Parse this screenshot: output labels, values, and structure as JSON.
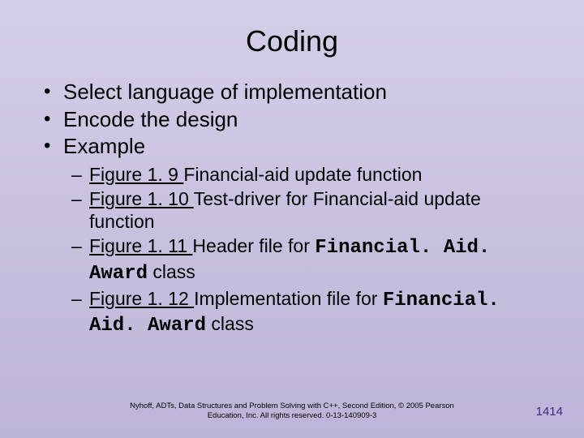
{
  "title": "Coding",
  "bullets": {
    "b1": "Select language of implementation",
    "b2": "Encode the design",
    "b3": "Example"
  },
  "sub": {
    "s1": {
      "link": "Figure 1. 9 ",
      "rest": "Financial-aid update function"
    },
    "s2": {
      "link": "Figure 1. 10 ",
      "rest": "Test-driver for Financial-aid update function"
    },
    "s3": {
      "link": "Figure 1. 11 ",
      "rest_a": "Header file for ",
      "code": "Financial. Aid. Award",
      "rest_b": " class"
    },
    "s4": {
      "link": "Figure 1. 12 ",
      "rest_a": "Implementation file for ",
      "code": "Financial. Aid. Award",
      "rest_b": " class"
    }
  },
  "footer": {
    "line1": "Nyhoff, ADTs, Data Structures and Problem Solving with C++, Second Edition, © 2005 Pearson",
    "line2": "Education, Inc. All rights reserved. 0-13-140909-3"
  },
  "pagenum": "1414"
}
